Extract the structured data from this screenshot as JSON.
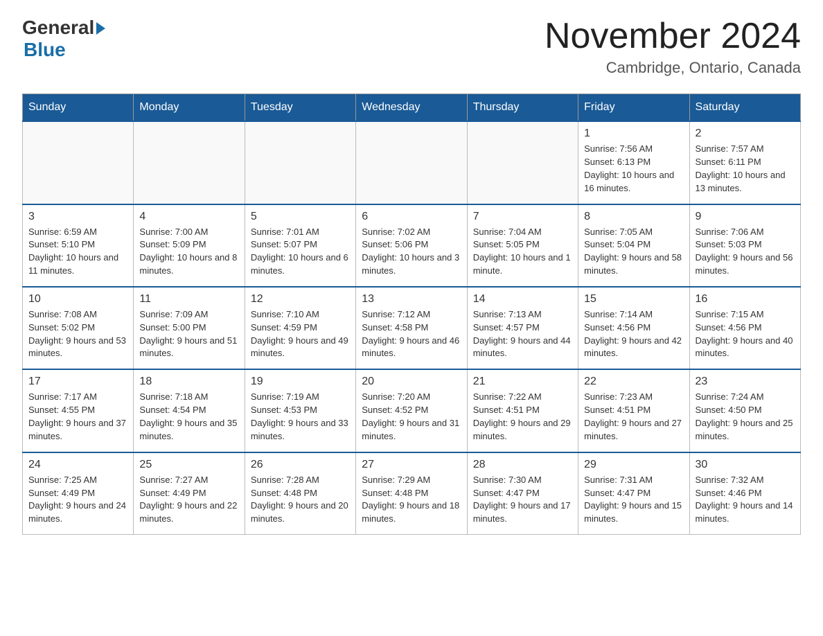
{
  "logo": {
    "general": "General",
    "blue": "Blue",
    "arrow": "▶"
  },
  "header": {
    "title": "November 2024",
    "location": "Cambridge, Ontario, Canada"
  },
  "weekdays": [
    "Sunday",
    "Monday",
    "Tuesday",
    "Wednesday",
    "Thursday",
    "Friday",
    "Saturday"
  ],
  "weeks": [
    [
      {
        "day": "",
        "info": ""
      },
      {
        "day": "",
        "info": ""
      },
      {
        "day": "",
        "info": ""
      },
      {
        "day": "",
        "info": ""
      },
      {
        "day": "",
        "info": ""
      },
      {
        "day": "1",
        "info": "Sunrise: 7:56 AM\nSunset: 6:13 PM\nDaylight: 10 hours and 16 minutes."
      },
      {
        "day": "2",
        "info": "Sunrise: 7:57 AM\nSunset: 6:11 PM\nDaylight: 10 hours and 13 minutes."
      }
    ],
    [
      {
        "day": "3",
        "info": "Sunrise: 6:59 AM\nSunset: 5:10 PM\nDaylight: 10 hours and 11 minutes."
      },
      {
        "day": "4",
        "info": "Sunrise: 7:00 AM\nSunset: 5:09 PM\nDaylight: 10 hours and 8 minutes."
      },
      {
        "day": "5",
        "info": "Sunrise: 7:01 AM\nSunset: 5:07 PM\nDaylight: 10 hours and 6 minutes."
      },
      {
        "day": "6",
        "info": "Sunrise: 7:02 AM\nSunset: 5:06 PM\nDaylight: 10 hours and 3 minutes."
      },
      {
        "day": "7",
        "info": "Sunrise: 7:04 AM\nSunset: 5:05 PM\nDaylight: 10 hours and 1 minute."
      },
      {
        "day": "8",
        "info": "Sunrise: 7:05 AM\nSunset: 5:04 PM\nDaylight: 9 hours and 58 minutes."
      },
      {
        "day": "9",
        "info": "Sunrise: 7:06 AM\nSunset: 5:03 PM\nDaylight: 9 hours and 56 minutes."
      }
    ],
    [
      {
        "day": "10",
        "info": "Sunrise: 7:08 AM\nSunset: 5:02 PM\nDaylight: 9 hours and 53 minutes."
      },
      {
        "day": "11",
        "info": "Sunrise: 7:09 AM\nSunset: 5:00 PM\nDaylight: 9 hours and 51 minutes."
      },
      {
        "day": "12",
        "info": "Sunrise: 7:10 AM\nSunset: 4:59 PM\nDaylight: 9 hours and 49 minutes."
      },
      {
        "day": "13",
        "info": "Sunrise: 7:12 AM\nSunset: 4:58 PM\nDaylight: 9 hours and 46 minutes."
      },
      {
        "day": "14",
        "info": "Sunrise: 7:13 AM\nSunset: 4:57 PM\nDaylight: 9 hours and 44 minutes."
      },
      {
        "day": "15",
        "info": "Sunrise: 7:14 AM\nSunset: 4:56 PM\nDaylight: 9 hours and 42 minutes."
      },
      {
        "day": "16",
        "info": "Sunrise: 7:15 AM\nSunset: 4:56 PM\nDaylight: 9 hours and 40 minutes."
      }
    ],
    [
      {
        "day": "17",
        "info": "Sunrise: 7:17 AM\nSunset: 4:55 PM\nDaylight: 9 hours and 37 minutes."
      },
      {
        "day": "18",
        "info": "Sunrise: 7:18 AM\nSunset: 4:54 PM\nDaylight: 9 hours and 35 minutes."
      },
      {
        "day": "19",
        "info": "Sunrise: 7:19 AM\nSunset: 4:53 PM\nDaylight: 9 hours and 33 minutes."
      },
      {
        "day": "20",
        "info": "Sunrise: 7:20 AM\nSunset: 4:52 PM\nDaylight: 9 hours and 31 minutes."
      },
      {
        "day": "21",
        "info": "Sunrise: 7:22 AM\nSunset: 4:51 PM\nDaylight: 9 hours and 29 minutes."
      },
      {
        "day": "22",
        "info": "Sunrise: 7:23 AM\nSunset: 4:51 PM\nDaylight: 9 hours and 27 minutes."
      },
      {
        "day": "23",
        "info": "Sunrise: 7:24 AM\nSunset: 4:50 PM\nDaylight: 9 hours and 25 minutes."
      }
    ],
    [
      {
        "day": "24",
        "info": "Sunrise: 7:25 AM\nSunset: 4:49 PM\nDaylight: 9 hours and 24 minutes."
      },
      {
        "day": "25",
        "info": "Sunrise: 7:27 AM\nSunset: 4:49 PM\nDaylight: 9 hours and 22 minutes."
      },
      {
        "day": "26",
        "info": "Sunrise: 7:28 AM\nSunset: 4:48 PM\nDaylight: 9 hours and 20 minutes."
      },
      {
        "day": "27",
        "info": "Sunrise: 7:29 AM\nSunset: 4:48 PM\nDaylight: 9 hours and 18 minutes."
      },
      {
        "day": "28",
        "info": "Sunrise: 7:30 AM\nSunset: 4:47 PM\nDaylight: 9 hours and 17 minutes."
      },
      {
        "day": "29",
        "info": "Sunrise: 7:31 AM\nSunset: 4:47 PM\nDaylight: 9 hours and 15 minutes."
      },
      {
        "day": "30",
        "info": "Sunrise: 7:32 AM\nSunset: 4:46 PM\nDaylight: 9 hours and 14 minutes."
      }
    ]
  ]
}
